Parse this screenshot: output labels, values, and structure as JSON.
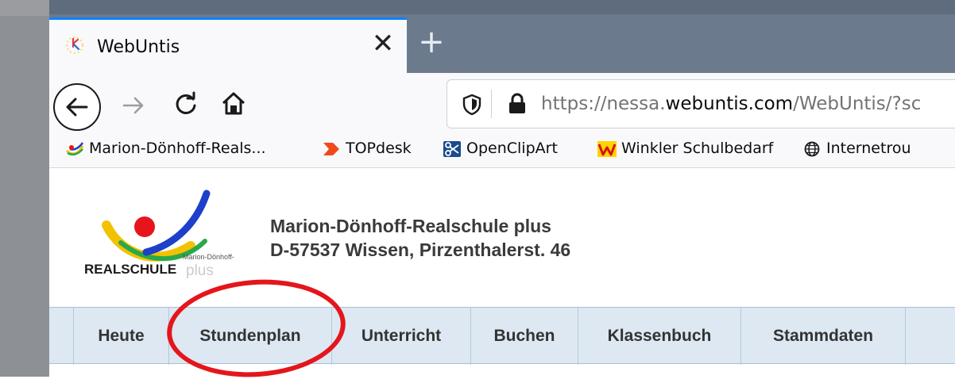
{
  "browser": {
    "tab_title": "WebUntis",
    "close_glyph": "✕",
    "newtab_glyph": "+",
    "url_prefix": "https://nessa.",
    "url_domain": "webuntis.com",
    "url_suffix": "/WebUntis/?sc"
  },
  "bookmarks": [
    {
      "label": "Marion-Dönhoff-Reals...",
      "icon": "school-logo-icon"
    },
    {
      "label": "TOPdesk",
      "icon": "topdesk-icon"
    },
    {
      "label": "OpenClipArt",
      "icon": "scissors-icon"
    },
    {
      "label": "Winkler Schulbedarf",
      "icon": "winkler-icon"
    },
    {
      "label": "Internetrou",
      "icon": "globe-icon"
    }
  ],
  "school": {
    "line1": "Marion-Dönhoff-Realschule plus",
    "line2": "D-57537 Wissen, Pirzenthalerst. 46",
    "logo_main": "REALSCHULE",
    "logo_plus": "plus",
    "logo_small": "Marion-Dönhoff-"
  },
  "menu": [
    "Heute",
    "Stundenplan",
    "Unterricht",
    "Buchen",
    "Klassenbuch",
    "Stammdaten"
  ],
  "colors": {
    "accent": "#0a84ff",
    "annotation": "#e4161c",
    "menu_bg": "#dde8f2"
  }
}
